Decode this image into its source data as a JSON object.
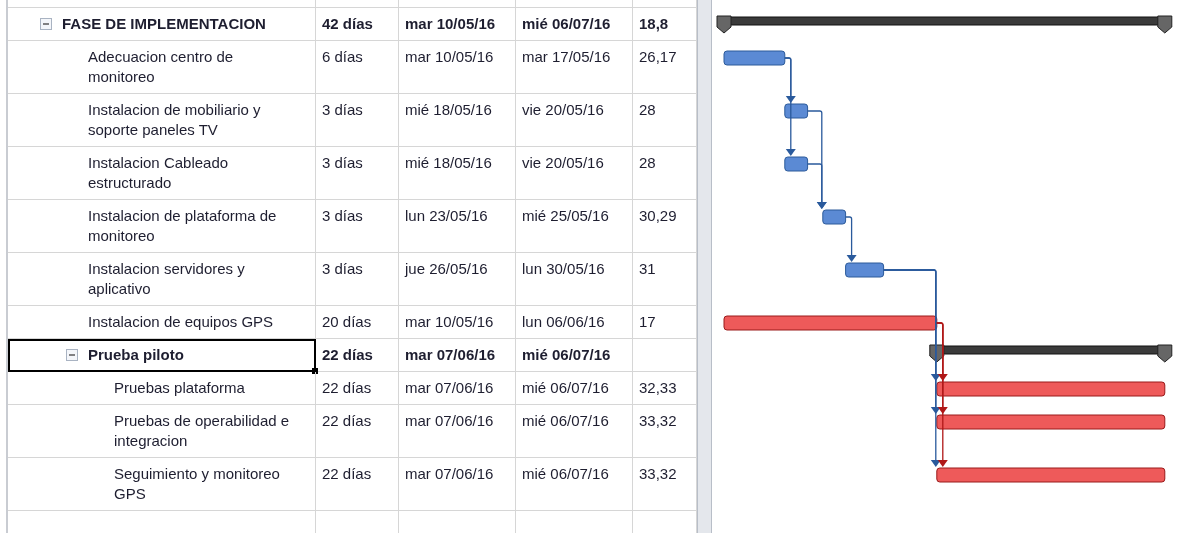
{
  "tasks": [
    {
      "kind": "summary",
      "name": "FASE DE IMPLEMENTACION",
      "duration": "42 días",
      "start": "mar 10/05/16",
      "finish": "mié 06/07/16",
      "col_5": "18,8",
      "expanded": true,
      "selected": false,
      "children": [
        {
          "kind": "task",
          "name": "Adecuacion centro de monitoreo",
          "duration": "6 días",
          "start": "mar 10/05/16",
          "finish": "mar 17/05/16",
          "col_5": "26,17",
          "selected": false,
          "critical": false
        },
        {
          "kind": "task",
          "name": "Instalacion de mobiliario y soporte paneles TV",
          "duration": "3 días",
          "start": "mié 18/05/16",
          "finish": "vie 20/05/16",
          "col_5": "28",
          "selected": false,
          "critical": false
        },
        {
          "kind": "task",
          "name": "Instalacion Cableado estructurado",
          "duration": "3 días",
          "start": "mié 18/05/16",
          "finish": "vie 20/05/16",
          "col_5": "28",
          "selected": false,
          "critical": false
        },
        {
          "kind": "task",
          "name": "Instalacion de plataforma de monitoreo",
          "duration": "3 días",
          "start": "lun 23/05/16",
          "finish": "mié 25/05/16",
          "col_5": "30,29",
          "selected": false,
          "critical": false
        },
        {
          "kind": "task",
          "name": "Instalacion servidores y aplicativo",
          "duration": "3 días",
          "start": "jue 26/05/16",
          "finish": "lun 30/05/16",
          "col_5": "31",
          "selected": false,
          "critical": false
        },
        {
          "kind": "task",
          "name": "Instalacion de equipos GPS",
          "duration": "20 días",
          "start": "mar 10/05/16",
          "finish": "lun 06/06/16",
          "col_5": "17",
          "selected": false,
          "critical": true
        },
        {
          "kind": "summary",
          "name": "Prueba piloto",
          "duration": "22 días",
          "start": "mar 07/06/16",
          "finish": "mié 06/07/16",
          "expanded": true,
          "selected": true,
          "children": [
            {
              "kind": "task",
              "name": "Pruebas plataforma",
              "duration": "22 días",
              "start": "mar 07/06/16",
              "finish": "mié 06/07/16",
              "col_5": "32,33",
              "selected": false,
              "critical": true
            },
            {
              "kind": "task",
              "name": "Pruebas de operabilidad e integracion",
              "duration": "22 días",
              "start": "mar 07/06/16",
              "finish": "mié 06/07/16",
              "col_5": "33,32",
              "selected": false,
              "critical": true
            },
            {
              "kind": "task",
              "name": "Seguimiento y monitoreo GPS",
              "duration": "22 días",
              "start": "mar 07/06/16",
              "finish": "mié 06/07/16",
              "col_5": "33,32",
              "selected": false,
              "critical": true
            }
          ]
        }
      ]
    }
  ]
}
